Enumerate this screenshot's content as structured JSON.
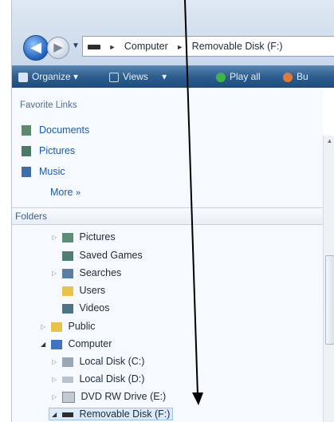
{
  "address_bar": {
    "crumbs": [
      "Computer",
      "Removable Disk (F:)"
    ]
  },
  "command_bar": {
    "organize": "Organize",
    "views": "Views",
    "play_all": "Play all",
    "burn": "Bu"
  },
  "favorite_links": {
    "header": "Favorite Links",
    "items": [
      "Documents",
      "Pictures",
      "Music"
    ],
    "more": "More"
  },
  "folders": {
    "header": "Folders",
    "items": [
      {
        "label": "Pictures",
        "icon": "pictures-folder-icon"
      },
      {
        "label": "Saved Games",
        "icon": "saved-games-folder-icon"
      },
      {
        "label": "Searches",
        "icon": "searches-folder-icon"
      },
      {
        "label": "Users",
        "icon": "folder-icon"
      },
      {
        "label": "Videos",
        "icon": "videos-folder-icon"
      },
      {
        "label": "Public",
        "icon": "folder-icon"
      },
      {
        "label": "Computer",
        "icon": "computer-icon"
      },
      {
        "label": "Local Disk (C:)",
        "icon": "hard-disk-icon"
      },
      {
        "label": "Local Disk (D:)",
        "icon": "hard-disk-icon"
      },
      {
        "label": "DVD RW Drive (E:)",
        "icon": "dvd-drive-icon"
      },
      {
        "label": "Removable Disk (F:)",
        "icon": "usb-drive-icon"
      }
    ]
  },
  "colors": {
    "accent": "#1d5aa8",
    "command_bar": "#2d5e8f"
  }
}
